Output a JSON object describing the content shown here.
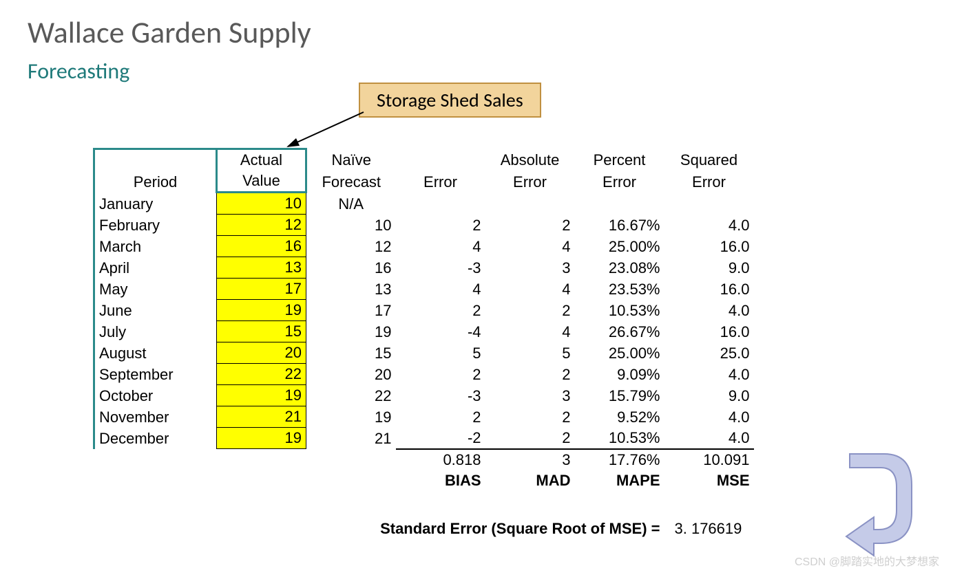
{
  "title": "Wallace Garden Supply",
  "subtitle": "Forecasting",
  "callout": "Storage Shed Sales",
  "headers": {
    "period": "Period",
    "actual_l1": "Actual",
    "actual_l2": "Value",
    "naive_l1": "Naïve",
    "naive_l2": "Forecast",
    "error": "Error",
    "abs_l1": "Absolute",
    "abs_l2": "Error",
    "pct_l1": "Percent",
    "pct_l2": "Error",
    "sq_l1": "Squared",
    "sq_l2": "Error"
  },
  "rows": [
    {
      "period": "January",
      "actual": "10",
      "naive": "N/A",
      "error": "",
      "abs": "",
      "pct": "",
      "sq": ""
    },
    {
      "period": "February",
      "actual": "12",
      "naive": "10",
      "error": "2",
      "abs": "2",
      "pct": "16.67%",
      "sq": "4.0"
    },
    {
      "period": "March",
      "actual": "16",
      "naive": "12",
      "error": "4",
      "abs": "4",
      "pct": "25.00%",
      "sq": "16.0"
    },
    {
      "period": "April",
      "actual": "13",
      "naive": "16",
      "error": "-3",
      "abs": "3",
      "pct": "23.08%",
      "sq": "9.0"
    },
    {
      "period": "May",
      "actual": "17",
      "naive": "13",
      "error": "4",
      "abs": "4",
      "pct": "23.53%",
      "sq": "16.0"
    },
    {
      "period": "June",
      "actual": "19",
      "naive": "17",
      "error": "2",
      "abs": "2",
      "pct": "10.53%",
      "sq": "4.0"
    },
    {
      "period": "July",
      "actual": "15",
      "naive": "19",
      "error": "-4",
      "abs": "4",
      "pct": "26.67%",
      "sq": "16.0"
    },
    {
      "period": "August",
      "actual": "20",
      "naive": "15",
      "error": "5",
      "abs": "5",
      "pct": "25.00%",
      "sq": "25.0"
    },
    {
      "period": "September",
      "actual": "22",
      "naive": "20",
      "error": "2",
      "abs": "2",
      "pct": "9.09%",
      "sq": "4.0"
    },
    {
      "period": "October",
      "actual": "19",
      "naive": "22",
      "error": "-3",
      "abs": "3",
      "pct": "15.79%",
      "sq": "9.0"
    },
    {
      "period": "November",
      "actual": "21",
      "naive": "19",
      "error": "2",
      "abs": "2",
      "pct": "9.52%",
      "sq": "4.0"
    },
    {
      "period": "December",
      "actual": "19",
      "naive": "21",
      "error": "-2",
      "abs": "2",
      "pct": "10.53%",
      "sq": "4.0"
    }
  ],
  "summary": {
    "bias_val": "0.818",
    "mad_val": "3",
    "mape_val": "17.76%",
    "mse_val": "10.091",
    "bias_lbl": "BIAS",
    "mad_lbl": "MAD",
    "mape_lbl": "MAPE",
    "mse_lbl": "MSE"
  },
  "se_label": "Standard Error (Square Root of MSE) =",
  "se_value": "3. 176619",
  "watermark": "CSDN @脚踏实地的大梦想家"
}
